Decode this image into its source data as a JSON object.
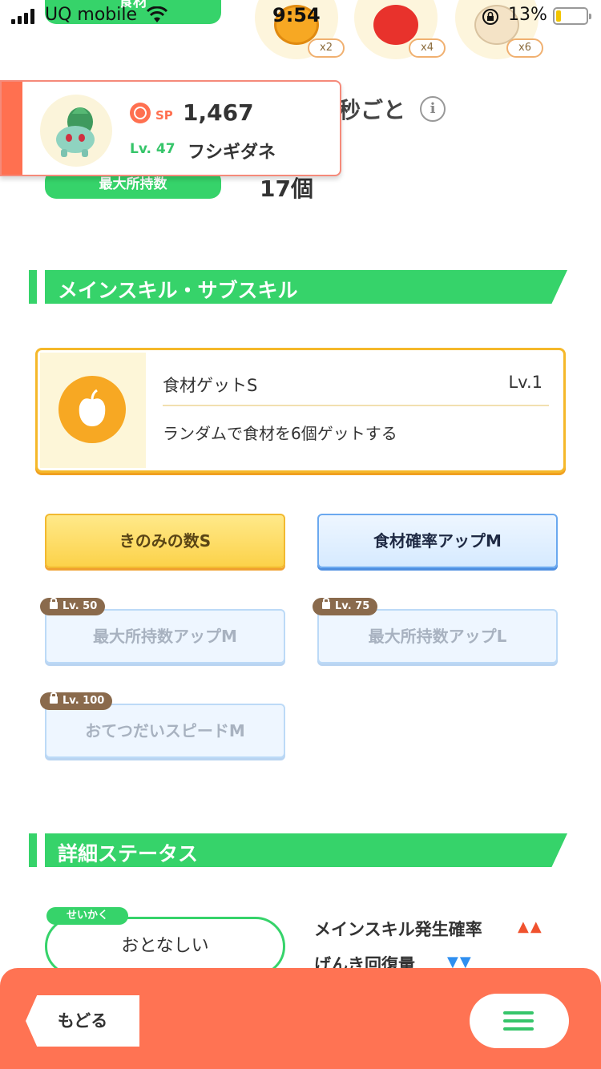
{
  "status_bar": {
    "carrier": "UQ mobile",
    "time": "9:54",
    "battery_percent": "13%",
    "icons": [
      "signal-icon",
      "wifi-icon",
      "orientation-lock-icon",
      "battery-icon"
    ]
  },
  "ingredients": {
    "label": "食材",
    "items": [
      {
        "name": "honey-icon",
        "count": "x2",
        "color": "#f7a823"
      },
      {
        "name": "tomato-icon",
        "count": "x4",
        "color": "#e8322c"
      },
      {
        "name": "egg-icon",
        "count": "x6",
        "color": "#f4e3c6"
      }
    ]
  },
  "header_stats": {
    "help_interval_suffix": "秒ごと",
    "info_icon": "i",
    "max_carry_label": "最大所持数",
    "max_carry_value": "17個"
  },
  "pokemon": {
    "sp_label": "SP",
    "sp_value": "1,467",
    "level": "Lv. 47",
    "name": "フシギダネ"
  },
  "skills_section": {
    "title": "メインスキル・サブスキル",
    "main_skill": {
      "name": "食材ゲットS",
      "level": "Lv.1",
      "description": "ランダムで食材を6個ゲットする"
    },
    "sub_skills": [
      {
        "label": "きのみの数S",
        "state": "active-gold"
      },
      {
        "label": "食材確率アップM",
        "state": "active-blue"
      },
      {
        "label": "最大所持数アップM",
        "state": "locked",
        "unlock_level": "Lv. 50"
      },
      {
        "label": "最大所持数アップL",
        "state": "locked",
        "unlock_level": "Lv. 75"
      },
      {
        "label": "おてつだいスピードM",
        "state": "locked",
        "unlock_level": "Lv. 100"
      }
    ]
  },
  "details_section": {
    "title": "詳細ステータス",
    "nature_label": "せいかく",
    "nature_value": "おとなしい",
    "effects": [
      {
        "label": "メインスキル発生確率",
        "arrows": "▲▲",
        "color": "#f0522e"
      },
      {
        "label": "げんき回復量",
        "arrows": "▼▼",
        "color": "#2f8ff0"
      }
    ]
  },
  "bottom_bar": {
    "back_label": "もどる",
    "menu_icon": "hamburger-menu-icon",
    "accent": "#ff7353"
  }
}
